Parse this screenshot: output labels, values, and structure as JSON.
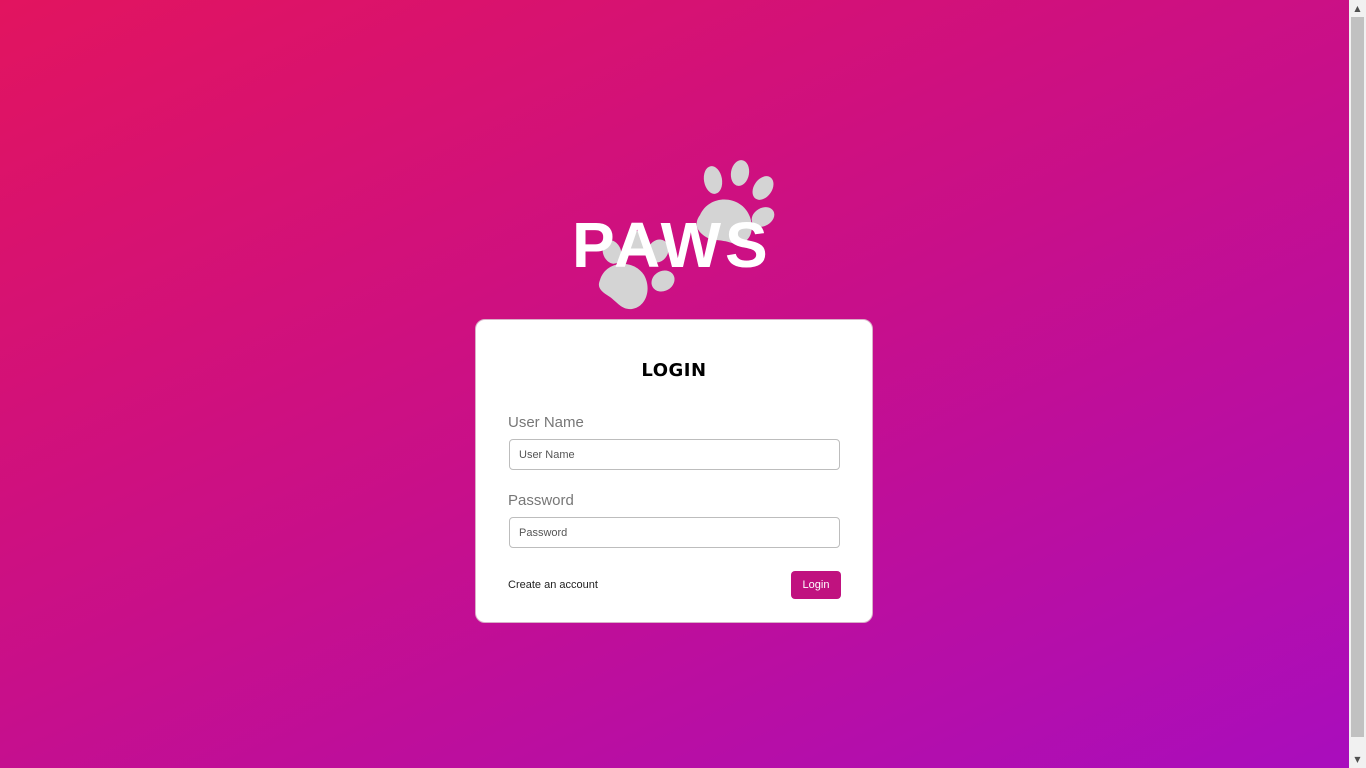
{
  "logo": {
    "text": "PAWS",
    "icon": "paw-prints-icon"
  },
  "login_card": {
    "title": "LOGIN",
    "username": {
      "label": "User Name",
      "placeholder": "User Name",
      "value": ""
    },
    "password": {
      "label": "Password",
      "placeholder": "Password",
      "value": ""
    },
    "create_account_label": "Create an account",
    "login_button_label": "Login"
  },
  "colors": {
    "background_start": "#e2145f",
    "background_end": "#a90dbd",
    "button": "#c0127f",
    "paw": "#d4d4d4"
  }
}
